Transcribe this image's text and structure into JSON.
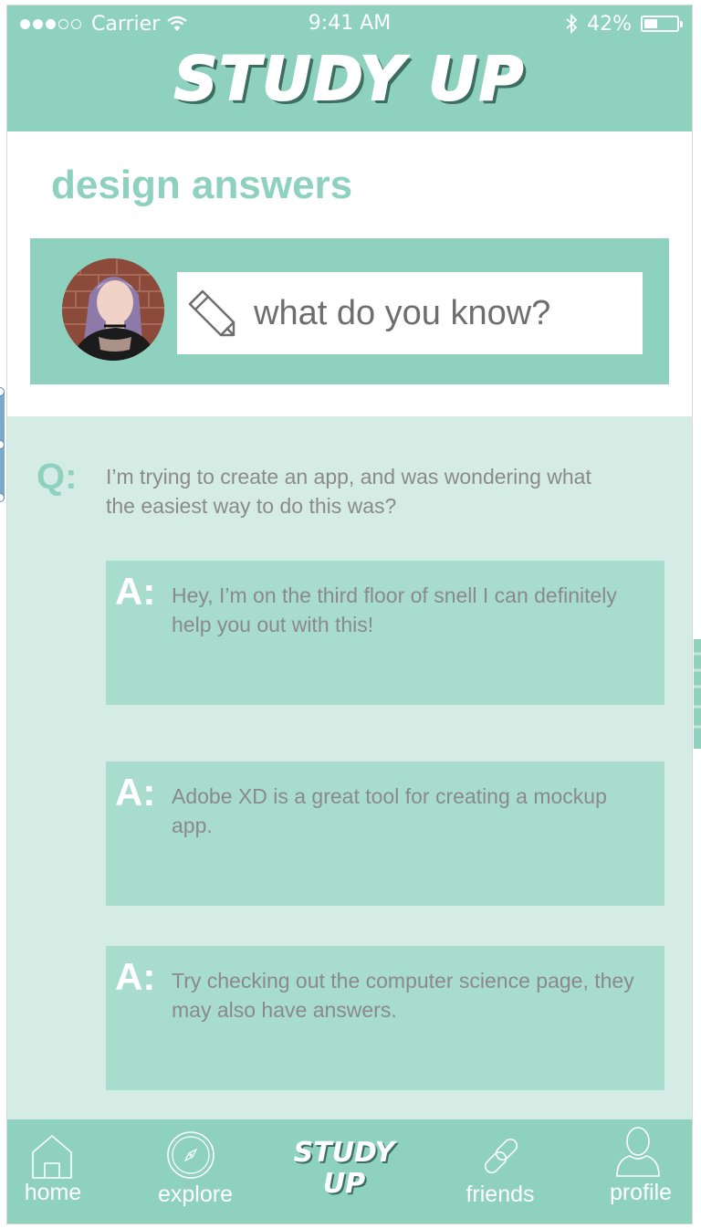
{
  "status_bar": {
    "carrier": "Carrier",
    "time": "9:41 AM",
    "battery_percent": "42%",
    "battery_level": 0.42,
    "signal_bars_filled": 3,
    "signal_bars_total": 5
  },
  "header": {
    "logo": "STUDY UP"
  },
  "page": {
    "title": "design answers"
  },
  "composer": {
    "placeholder": "what do you know?",
    "avatar_icon": "user-avatar-photo",
    "edit_icon": "pencil-icon"
  },
  "question": {
    "label": "Q:",
    "text": "I’m trying to create an app, and was wondering what the easiest way to do this was?"
  },
  "answers": [
    {
      "label": "A:",
      "text": "Hey, I’m on the third floor of snell I can definitely help you out with this!"
    },
    {
      "label": "A:",
      "text": "Adobe XD is a great tool for creating a mockup app."
    },
    {
      "label": "A:",
      "text": "Try checking out the computer science page, they may also have answers."
    }
  ],
  "tabbar": {
    "home": "home",
    "explore": "explore",
    "logo_line1": "STUDY",
    "logo_line2": "UP",
    "friends": "friends",
    "profile": "profile"
  },
  "colors": {
    "mint": "#8fd1bf",
    "mint_light": "#d5ece5",
    "mint_card": "#a8dccc",
    "text_gray": "#8a8a8a",
    "logo_shadow": "#3c6e62"
  }
}
